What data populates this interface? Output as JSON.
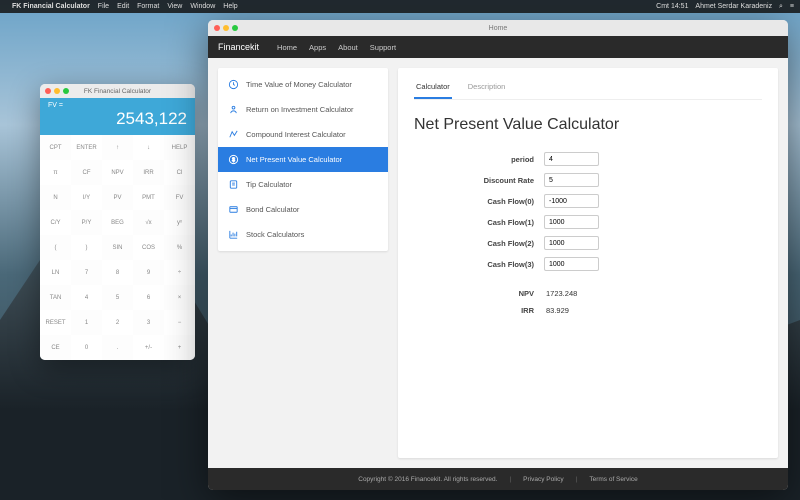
{
  "menubar": {
    "app": "FK Financial Calculator",
    "items": [
      "File",
      "Edit",
      "Format",
      "View",
      "Window",
      "Help"
    ],
    "clock": "Cmt 14:51",
    "user": "Ahmet Serdar Karadeniz"
  },
  "calc": {
    "title": "FK Financial Calculator",
    "fv_label": "FV    =",
    "value": "2543,122",
    "buttons": [
      "CPT",
      "ENTER",
      "↑",
      "↓",
      "HELP",
      "π",
      "CF",
      "NPV",
      "IRR",
      "Cl",
      "N",
      "I/Y",
      "PV",
      "PMT",
      "FV",
      "C/Y",
      "P/Y",
      "BEG",
      "√x",
      "yˣ",
      "(",
      ")",
      "SIN",
      "COS",
      "%",
      "LN",
      "7",
      "8",
      "9",
      "÷",
      "TAN",
      "4",
      "5",
      "6",
      "×",
      "RESET",
      "1",
      "2",
      "3",
      "−",
      "CE",
      "0",
      ".",
      "+/-",
      "+"
    ]
  },
  "main": {
    "title": "Home",
    "brand": "Financekit",
    "nav": [
      "Home",
      "Apps",
      "About",
      "Support"
    ],
    "sidebar": [
      "Time Value of Money Calculator",
      "Return on Investment Calculator",
      "Compound Interest Calculator",
      "Net Present Value Calculator",
      "Tip Calculator",
      "Bond Calculator",
      "Stock Calculators"
    ],
    "tabs": [
      "Calculator",
      "Description"
    ],
    "heading": "Net Present Value Calculator",
    "fields": [
      {
        "label": "period",
        "value": "4"
      },
      {
        "label": "Discount Rate",
        "value": "5"
      },
      {
        "label": "Cash Flow(0)",
        "value": "-1000"
      },
      {
        "label": "Cash Flow(1)",
        "value": "1000"
      },
      {
        "label": "Cash Flow(2)",
        "value": "1000"
      },
      {
        "label": "Cash Flow(3)",
        "value": "1000"
      }
    ],
    "results": [
      {
        "label": "NPV",
        "value": "1723.248"
      },
      {
        "label": "IRR",
        "value": "83.929"
      }
    ],
    "footer": {
      "copyright": "Copyright © 2016 Financekit. All rights reserved.",
      "privacy": "Privacy Policy",
      "terms": "Terms of Service"
    }
  }
}
